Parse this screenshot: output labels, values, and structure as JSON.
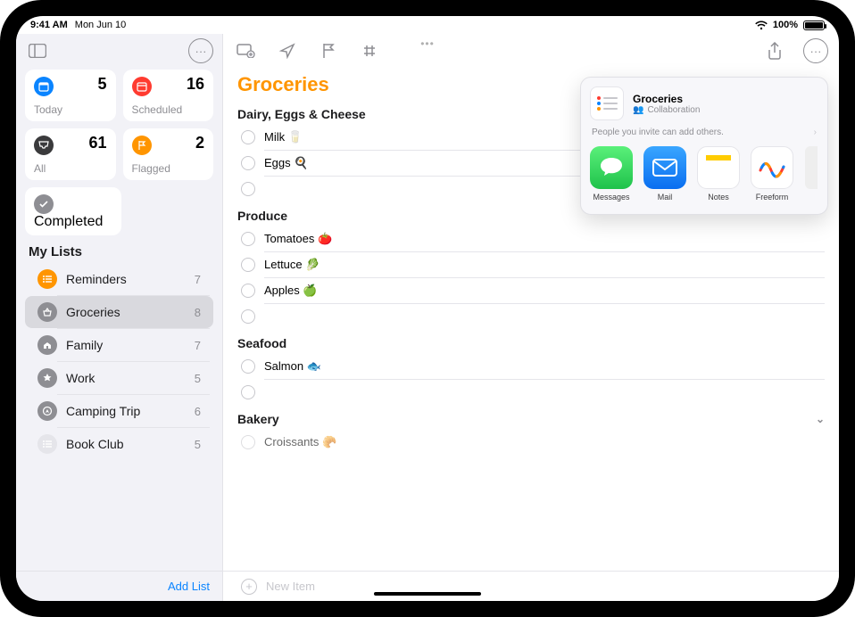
{
  "statusbar": {
    "time": "9:41 AM",
    "date": "Mon Jun 10",
    "battery_pct": "100%"
  },
  "sidebar": {
    "smartlists": [
      {
        "label": "Today",
        "count": "5"
      },
      {
        "label": "Scheduled",
        "count": "16"
      },
      {
        "label": "All",
        "count": "61"
      },
      {
        "label": "Flagged",
        "count": "2"
      }
    ],
    "completed_label": "Completed",
    "mylists_heading": "My Lists",
    "lists": [
      {
        "name": "Reminders",
        "count": "7"
      },
      {
        "name": "Groceries",
        "count": "8"
      },
      {
        "name": "Family",
        "count": "7"
      },
      {
        "name": "Work",
        "count": "5"
      },
      {
        "name": "Camping Trip",
        "count": "6"
      },
      {
        "name": "Book Club",
        "count": "5"
      }
    ],
    "add_list_label": "Add List"
  },
  "detail": {
    "title": "Groceries",
    "sections": [
      {
        "heading": "Dairy, Eggs & Cheese",
        "items": [
          "Milk 🥛",
          "Eggs 🍳"
        ]
      },
      {
        "heading": "Produce",
        "items": [
          "Tomatoes 🍅",
          "Lettuce 🥬",
          "Apples 🍏"
        ]
      },
      {
        "heading": "Seafood",
        "items": [
          "Salmon 🐟"
        ]
      },
      {
        "heading": "Bakery",
        "items": [
          "Croissants 🥐"
        ]
      }
    ],
    "new_item_placeholder": "New Item"
  },
  "share": {
    "title": "Groceries",
    "subtitle": "Collaboration",
    "note": "People you invite can add others.",
    "apps": [
      "Messages",
      "Mail",
      "Notes",
      "Freeform"
    ]
  }
}
